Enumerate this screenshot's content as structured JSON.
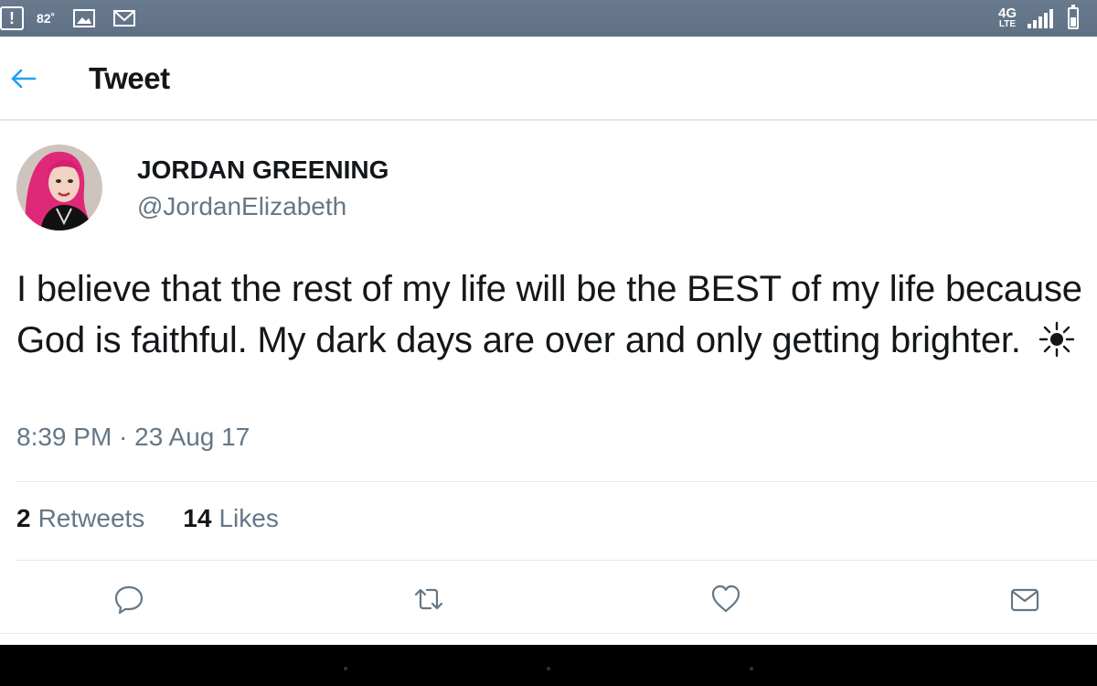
{
  "status_bar": {
    "temperature": "82˚",
    "network": "4G",
    "network_sub": "LTE",
    "icons": [
      "alert-icon",
      "image-icon",
      "gmail-icon",
      "signal-icon",
      "battery-icon"
    ]
  },
  "header": {
    "back_icon": "arrow-left-icon",
    "title": "Tweet"
  },
  "tweet": {
    "author_name": "JORDAN GREENING",
    "author_handle": "@JordanElizabeth",
    "text": "I believe that the rest of my life will be the BEST of my life because God is faithful. My dark days are over and only getting brighter.",
    "emoji_icon": "sun-icon",
    "timestamp": "8:39 PM · 23 Aug 17",
    "retweets_count": "2",
    "retweets_label": "Retweets",
    "likes_count": "14",
    "likes_label": "Likes"
  },
  "actions": [
    "reply-icon",
    "retweet-icon",
    "like-icon",
    "share-icon"
  ],
  "colors": {
    "accent": "#1da1f2",
    "text_primary": "#14171a",
    "text_secondary": "#657786",
    "status_bar": "#627288"
  }
}
